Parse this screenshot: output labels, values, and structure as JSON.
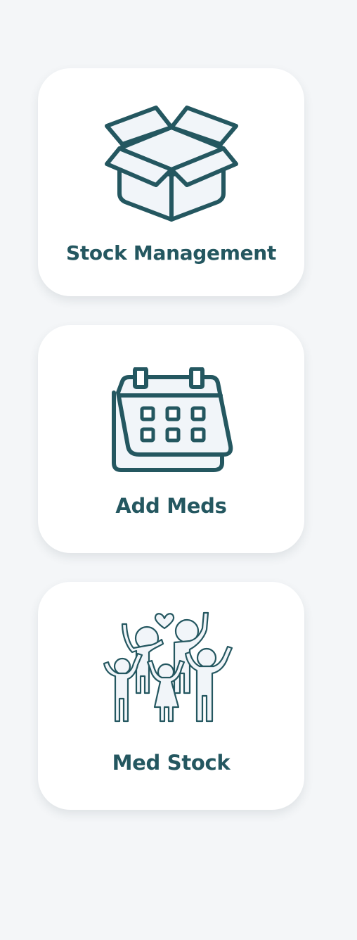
{
  "colors": {
    "background": "#f4f6f8",
    "card": "#ffffff",
    "accent": "#245760",
    "icon_fill": "#f1f5f9"
  },
  "menu": [
    {
      "label": "Stock Management",
      "icon": "open-box-icon"
    },
    {
      "label": "Add Meds",
      "icon": "calendar-icon"
    },
    {
      "label": "Med Stock",
      "icon": "family-icon"
    }
  ]
}
